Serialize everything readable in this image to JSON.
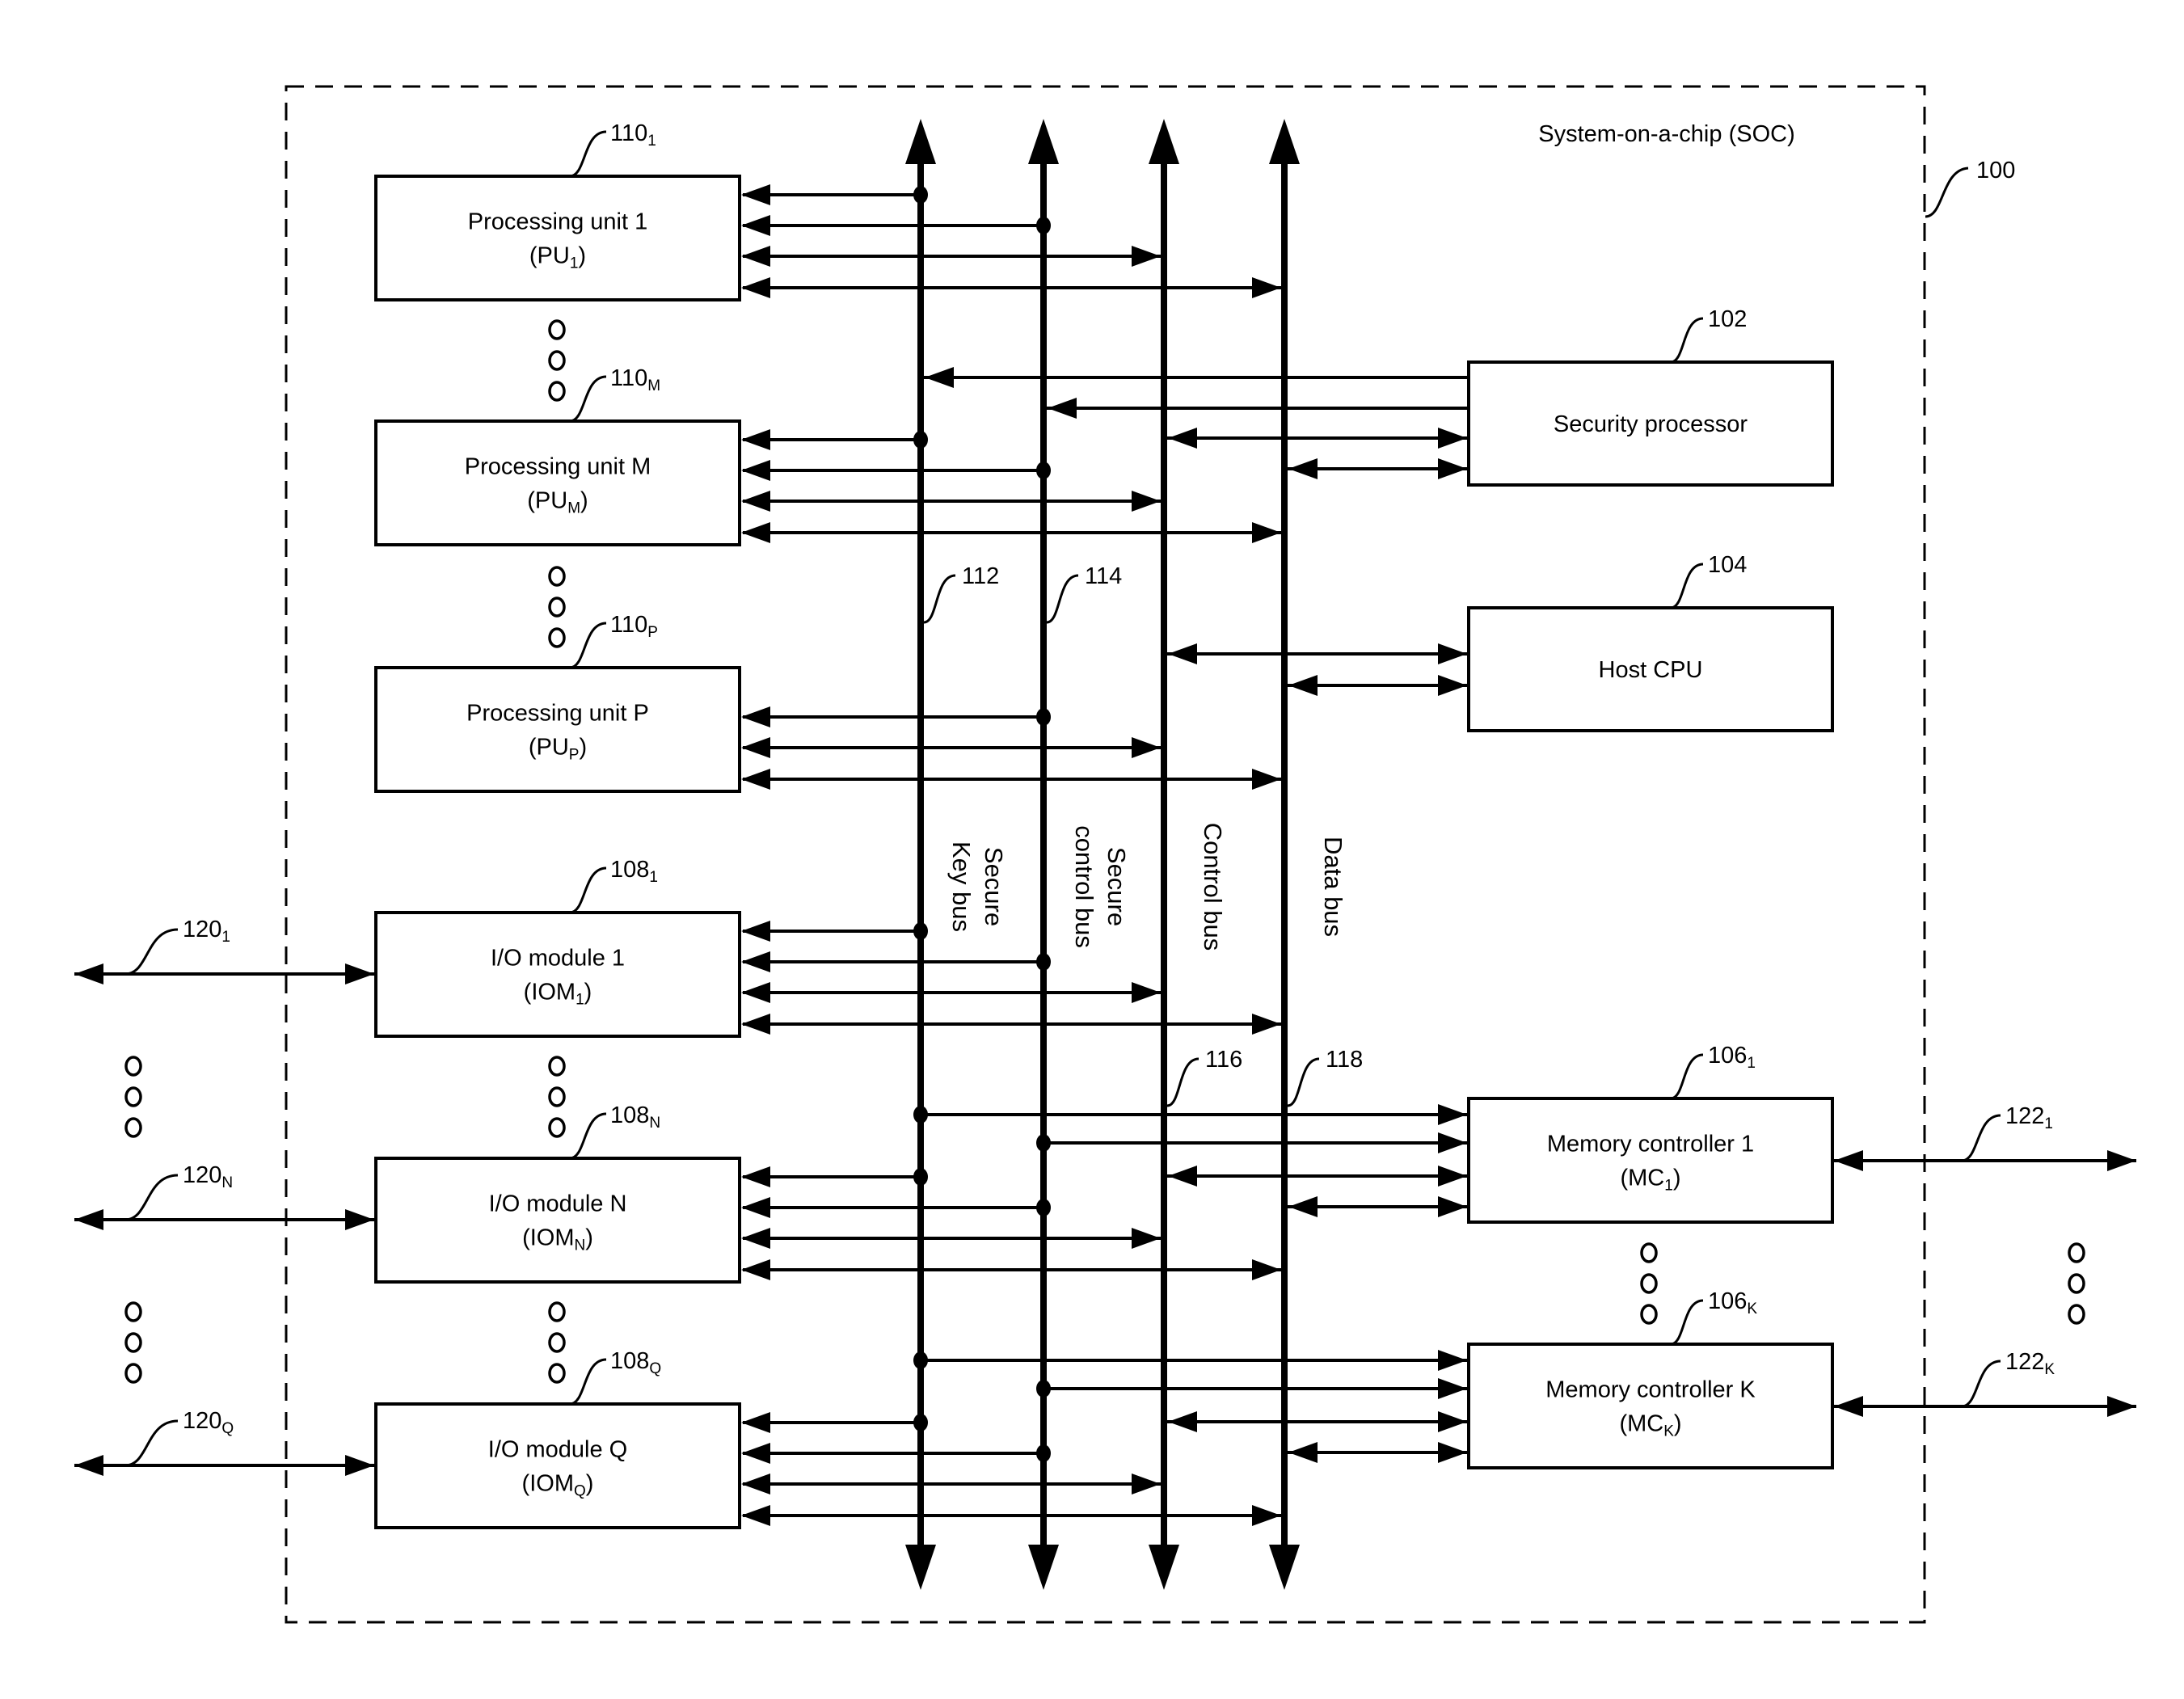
{
  "soc": {
    "title": "System-on-a-chip (SOC)",
    "ref": "100"
  },
  "buses": [
    {
      "id": "key",
      "lines": [
        "Secure",
        "Key bus"
      ],
      "ref": "112"
    },
    {
      "id": "sctrl",
      "lines": [
        "Secure",
        "control bus"
      ],
      "ref": "114"
    },
    {
      "id": "ctrl",
      "lines": [
        "Control bus"
      ],
      "ref": "116"
    },
    {
      "id": "data",
      "lines": [
        "Data bus"
      ],
      "ref": "118"
    }
  ],
  "processing_units": [
    {
      "name": "Processing unit 1",
      "abbr": "PU",
      "sub": "1",
      "ref": "110",
      "ref_sub": "1",
      "connects": [
        "key",
        "sctrl",
        "ctrl",
        "data"
      ]
    },
    {
      "name": "Processing unit M",
      "abbr": "PU",
      "sub": "M",
      "ref": "110",
      "ref_sub": "M",
      "connects": [
        "key",
        "sctrl",
        "ctrl",
        "data"
      ]
    },
    {
      "name": "Processing unit P",
      "abbr": "PU",
      "sub": "P",
      "ref": "110",
      "ref_sub": "P",
      "connects": [
        "sctrl",
        "ctrl",
        "data"
      ]
    }
  ],
  "io_modules": [
    {
      "name": "I/O module 1",
      "abbr": "IOM",
      "sub": "1",
      "ref": "108",
      "ref_sub": "1",
      "ext_ref": "120",
      "ext_sub": "1"
    },
    {
      "name": "I/O module N",
      "abbr": "IOM",
      "sub": "N",
      "ref": "108",
      "ref_sub": "N",
      "ext_ref": "120",
      "ext_sub": "N"
    },
    {
      "name": "I/O module Q",
      "abbr": "IOM",
      "sub": "Q",
      "ref": "108",
      "ref_sub": "Q",
      "ext_ref": "120",
      "ext_sub": "Q"
    }
  ],
  "security_processor": {
    "name": "Security processor",
    "ref": "102"
  },
  "host_cpu": {
    "name": "Host CPU",
    "ref": "104"
  },
  "memory_controllers": [
    {
      "name": "Memory controller 1",
      "abbr": "MC",
      "sub": "1",
      "ref": "106",
      "ref_sub": "1",
      "ext_ref": "122",
      "ext_sub": "1"
    },
    {
      "name": "Memory controller K",
      "abbr": "MC",
      "sub": "K",
      "ref": "106",
      "ref_sub": "K",
      "ext_ref": "122",
      "ext_sub": "K"
    }
  ]
}
